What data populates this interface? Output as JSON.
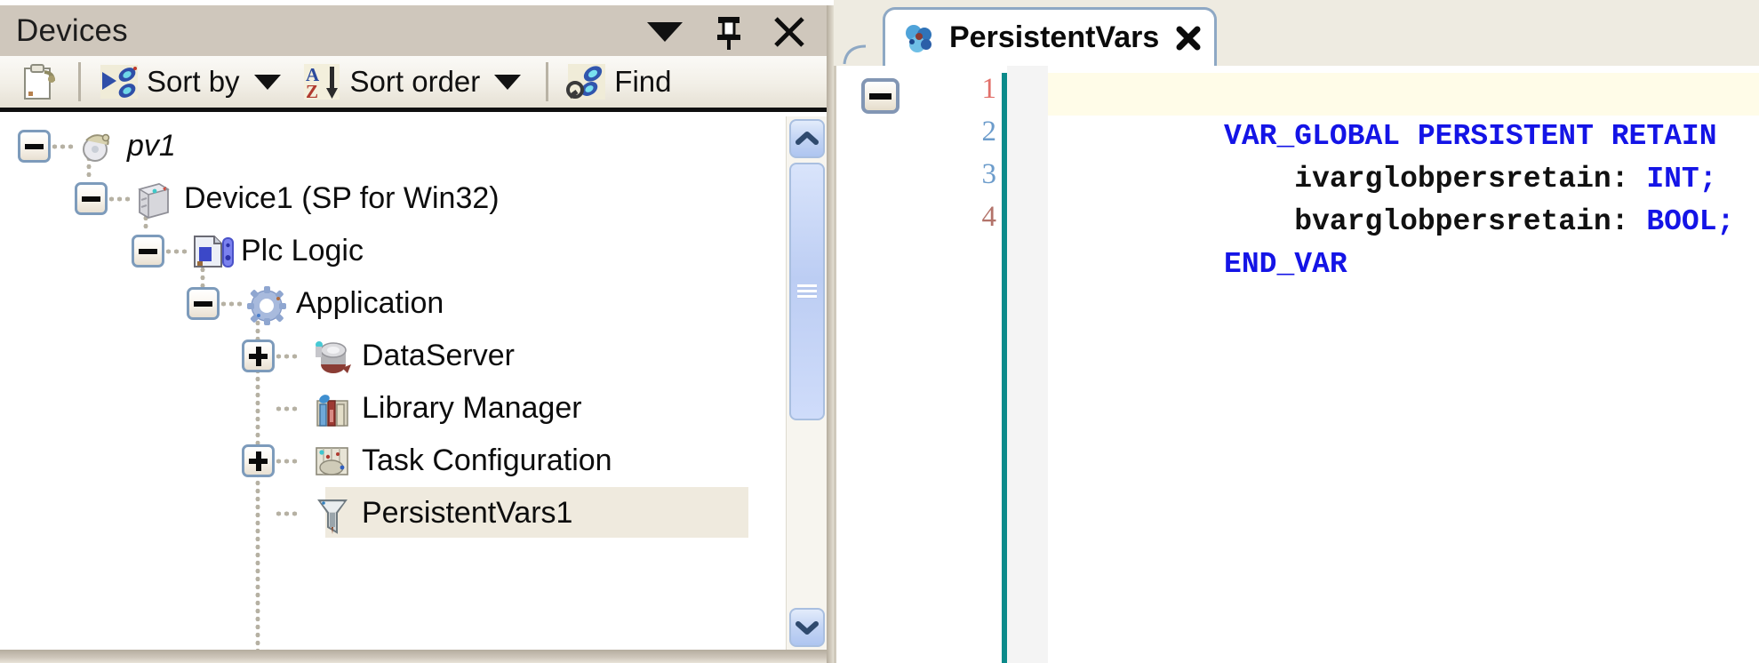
{
  "devices_panel": {
    "title": "Devices",
    "title_buttons": [
      {
        "name": "dropdown-menu-button",
        "icon": "chevron-down-icon",
        "label": "▼"
      },
      {
        "name": "auto-hide-pin-button",
        "icon": "pin-icon",
        "label": "ᐃ"
      },
      {
        "name": "close-panel-button",
        "icon": "close-icon",
        "label": "✕"
      }
    ],
    "toolbar": [
      {
        "name": "new-object-button",
        "icon": "clipboard-new-icon",
        "label": ""
      },
      {
        "name": "sort-by-button",
        "icon": "sort-by-icon",
        "label": "Sort by",
        "has_caret": true
      },
      {
        "name": "sort-order-button",
        "icon": "sort-order-icon",
        "label": "Sort order",
        "has_caret": true
      },
      {
        "name": "find-button",
        "icon": "find-icon",
        "label": "Find",
        "has_caret": false
      }
    ],
    "tree": [
      {
        "label": "pv1",
        "depth": 0,
        "toggle": "minus",
        "icon": "project-icon",
        "italic": true,
        "selected": false
      },
      {
        "label": "Device1 (SP for Win32)",
        "depth": 1,
        "toggle": "minus",
        "icon": "device-icon",
        "italic": false,
        "selected": false
      },
      {
        "label": "Plc Logic",
        "depth": 2,
        "toggle": "minus",
        "icon": "plc-logic-icon",
        "italic": false,
        "selected": false
      },
      {
        "label": "Application",
        "depth": 3,
        "toggle": "minus",
        "icon": "application-gear-icon",
        "italic": false,
        "selected": false
      },
      {
        "label": "DataServer",
        "depth": 4,
        "toggle": "plus",
        "icon": "dataserver-icon",
        "italic": false,
        "selected": false
      },
      {
        "label": "Library Manager",
        "depth": 4,
        "toggle": "none",
        "icon": "library-manager-icon",
        "italic": false,
        "selected": false
      },
      {
        "label": "Task Configuration",
        "depth": 4,
        "toggle": "plus",
        "icon": "task-configuration-icon",
        "italic": false,
        "selected": false
      },
      {
        "label": "PersistentVars1",
        "depth": 4,
        "toggle": "none",
        "icon": "persistent-vars-icon",
        "italic": false,
        "selected": true
      }
    ],
    "scrollbar": {
      "up_button": "scroll-up-arrow-icon",
      "down_button": "scroll-down-arrow-icon",
      "thumb": "scrollbar-thumb"
    }
  },
  "editor": {
    "tab": {
      "label": "PersistentVars",
      "icon": "persistent-vars-tab-icon",
      "close": "✖"
    },
    "fold_marker": "minus",
    "line_numbers": [
      "1",
      "2",
      "3",
      "4"
    ],
    "line_number_colors": [
      "#e2706a",
      "#6c9ccb",
      "#6c9ccb",
      "#b3736a"
    ],
    "current_line": 1,
    "code_lines": [
      {
        "num": 1,
        "tokens": [
          {
            "t": "VAR_GLOBAL PERSISTENT RETAIN",
            "c": "kw"
          }
        ]
      },
      {
        "num": 2,
        "tokens": [
          {
            "t": "    ivarglobpersretain",
            "c": "ident"
          },
          {
            "t": ": ",
            "c": "ident"
          },
          {
            "t": "INT;",
            "c": "kw"
          }
        ]
      },
      {
        "num": 3,
        "tokens": [
          {
            "t": "    bvarglobpersretain",
            "c": "ident"
          },
          {
            "t": ": ",
            "c": "ident"
          },
          {
            "t": "BOOL;",
            "c": "kw"
          }
        ]
      },
      {
        "num": 4,
        "tokens": [
          {
            "t": "END_VAR",
            "c": "kw"
          }
        ]
      }
    ]
  },
  "colors": {
    "titlebar_bg": "#cfc7bc",
    "toolbar_bg": "#f2efe7",
    "tree_bg": "#ffffff",
    "selection_bg": "#efeade",
    "tab_border": "#8ea8c4",
    "keyword": "#1414e6",
    "identifier": "#111111",
    "current_line_bg": "#fffce8",
    "gutter_rule": "#0b8a8a",
    "margin_strip": "#f4f4f4",
    "scrollbar_blue": "#bccdf3"
  }
}
